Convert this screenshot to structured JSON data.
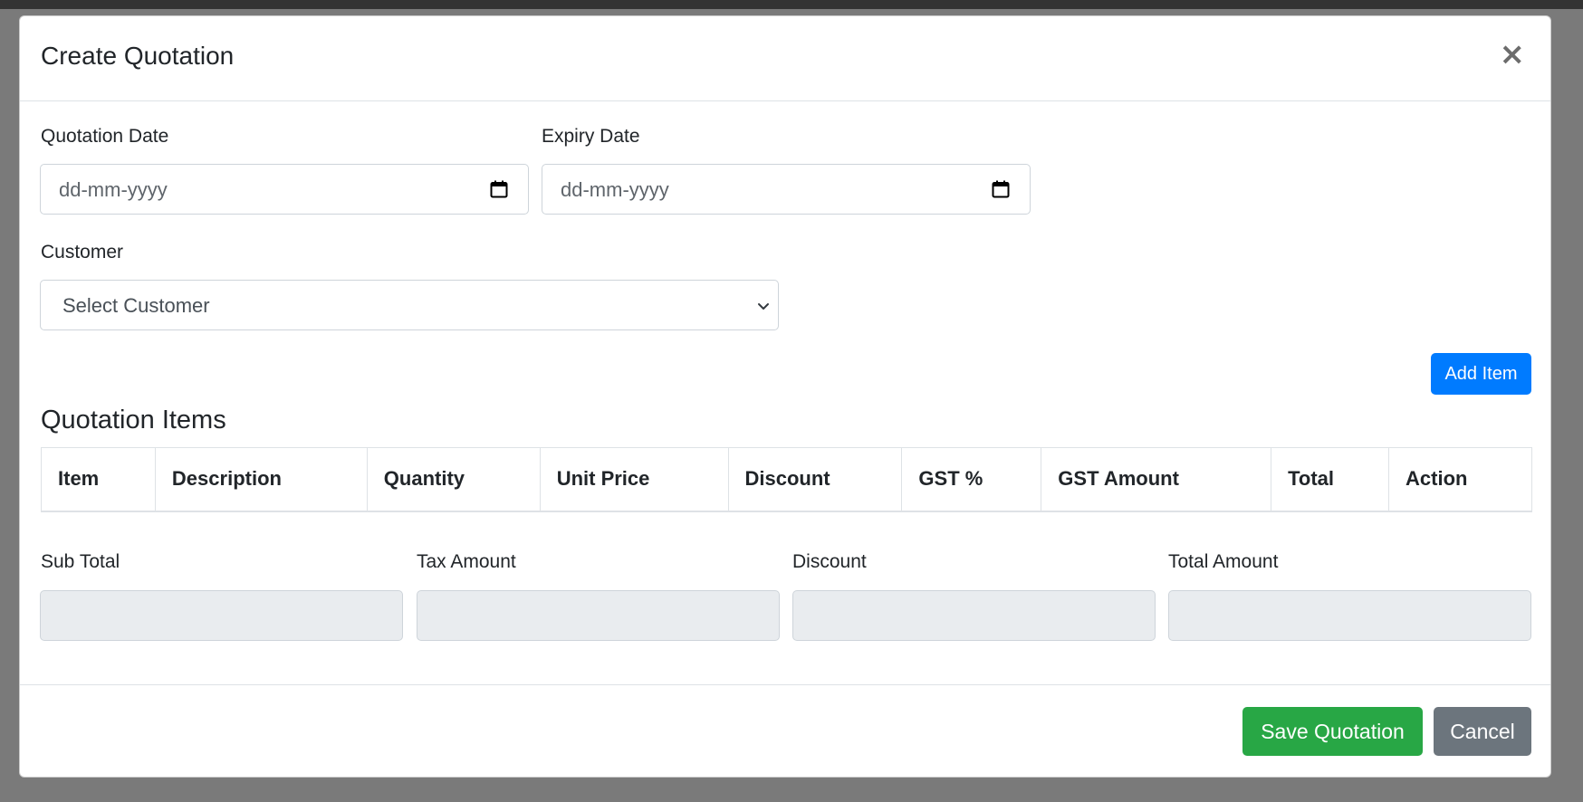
{
  "modal": {
    "title": "Create Quotation",
    "close_label": "×"
  },
  "form": {
    "quotation_date": {
      "label": "Quotation Date",
      "placeholder": "dd-mm-yyyy",
      "value": ""
    },
    "expiry_date": {
      "label": "Expiry Date",
      "placeholder": "dd-mm-yyyy",
      "value": ""
    },
    "customer": {
      "label": "Customer",
      "selected": "Select Customer"
    }
  },
  "items": {
    "add_label": "Add Item",
    "title": "Quotation Items",
    "columns": [
      "Item",
      "Description",
      "Quantity",
      "Unit Price",
      "Discount",
      "GST %",
      "GST Amount",
      "Total",
      "Action"
    ]
  },
  "totals": {
    "sub_total": {
      "label": "Sub Total",
      "value": ""
    },
    "tax_amount": {
      "label": "Tax Amount",
      "value": ""
    },
    "discount": {
      "label": "Discount",
      "value": ""
    },
    "total_amount": {
      "label": "Total Amount",
      "value": ""
    }
  },
  "footer": {
    "save_label": "Save Quotation",
    "cancel_label": "Cancel"
  },
  "colors": {
    "primary": "#007bff",
    "success": "#28a745",
    "secondary": "#6c757d",
    "readonly_bg": "#e9ecef"
  },
  "icons": [
    "close-icon",
    "calendar-icon",
    "chevron-down-icon"
  ]
}
